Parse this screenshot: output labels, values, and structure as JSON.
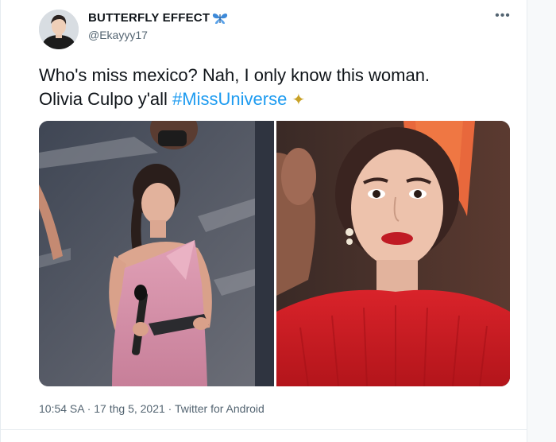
{
  "tweet": {
    "display_name": "BUTTERFLY EFFECT",
    "name_emoji_icon": "butterfly-icon",
    "handle": "@Ekayyy17",
    "text_line1": "Who's miss mexico? Nah, I only know this woman.",
    "text_line2_prefix": "Olivia Culpo y'all ",
    "hashtag": "#MissUniverse",
    "sparkle": "✦",
    "timestamp": "10:54 SA · 17 thg 5, 2021 · ",
    "source": "Twitter for Android",
    "more_icon": "more-horizontal-icon",
    "accent_color": "#1d9bf0"
  }
}
